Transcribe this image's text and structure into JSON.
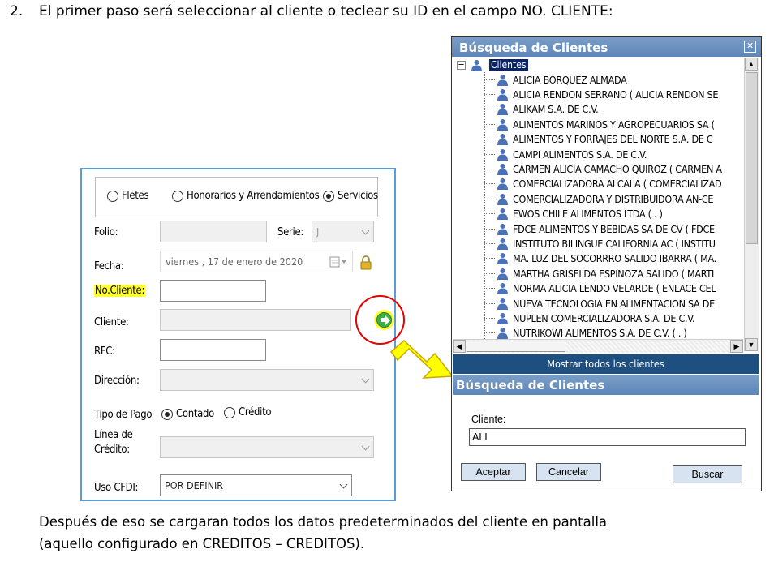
{
  "step": {
    "number": "2.",
    "text": "El primer paso será seleccionar al cliente o teclear su ID en el campo NO. CLIENTE:"
  },
  "after_text": {
    "line1": "Después de eso se cargaran todos los datos predeterminados del cliente en pantalla",
    "line2": "(aquello configurado en CREDITOS – CREDITOS)."
  },
  "form": {
    "radios": {
      "fletes": "Fletes",
      "honorarios": "Honorarios y Arrendamientos",
      "servicios": "Servicios",
      "selected": "servicios"
    },
    "folio_label": "Folio:",
    "serie_label": "Serie:",
    "serie_value": "J",
    "fecha_label": "Fecha:",
    "fecha_value": "viernes , 17 de    enero    de 2020",
    "no_cliente_label": "No.Cliente:",
    "cliente_label": "Cliente:",
    "rfc_label": "RFC:",
    "direccion_label": "Dirección:",
    "tipo_pago_label": "Tipo de Pago",
    "tipo_pago_contado": "Contado",
    "tipo_pago_credito": "Crédito",
    "tipo_pago_selected": "contado",
    "linea_credito_label_1": "Línea de",
    "linea_credito_label_2": "Crédito:",
    "uso_cfdi_label": "Uso CFDI:",
    "uso_cfdi_value": "POR DEFINIR",
    "highlight_color": "#ffff33"
  },
  "dialog": {
    "title": "Búsqueda de Clientes",
    "close_glyph": "✕",
    "tree_root": "Clientes",
    "clients": [
      "ALICIA BORQUEZ ALMADA",
      "ALICIA RENDON SERRANO ( ALICIA RENDON SE",
      "ALIKAM S.A. DE C.V.",
      "ALIMENTOS MARINOS Y AGROPECUARIOS SA (",
      "ALIMENTOS Y FORRAJES DEL NORTE S.A. DE C",
      "CAMPI ALIMENTOS S.A. DE C.V.",
      "CARMEN ALICIA CAMACHO QUIROZ ( CARMEN A",
      "COMERCIALIZADORA ALCALA ( COMERCIALIZAD",
      "COMERCIALIZADORA Y DISTRIBUIDORA AN-CE",
      "EWOS CHILE ALIMENTOS LTDA ( . )",
      "FDCE ALIMENTOS Y BEBIDAS SA DE CV ( FDCE",
      "INSTITUTO BILINGUE CALIFORNIA AC ( INSTITU",
      "MA. LUZ DEL SOCORRRO SALIDO IBARRA ( MA.",
      "MARTHA GRISELDA ESPINOZA SALIDO ( MARTI",
      "NORMA ALICIA LENDO VELARDE ( ENLACE CEL",
      "NUEVA TECNOLOGIA EN ALIMENTACION SA DE",
      "NUPLEN COMERCIALIZADORA S.A. DE C.V.",
      "NUTRIKOWI ALIMENTOS S.A. DE C.V.  ( . )"
    ],
    "show_all": "Mostrar todos los clientes",
    "search_title": "Búsqueda de Clientes",
    "cliente_label": "Cliente:",
    "cliente_value": "ALI",
    "accept": "Aceptar",
    "cancel": "Cancelar",
    "search": "Buscar",
    "title_color": "#6b93c0",
    "show_all_color": "#1d4f80"
  },
  "annotation": {
    "circle_color": "#e60000",
    "arrow_color": "#ffff00"
  }
}
